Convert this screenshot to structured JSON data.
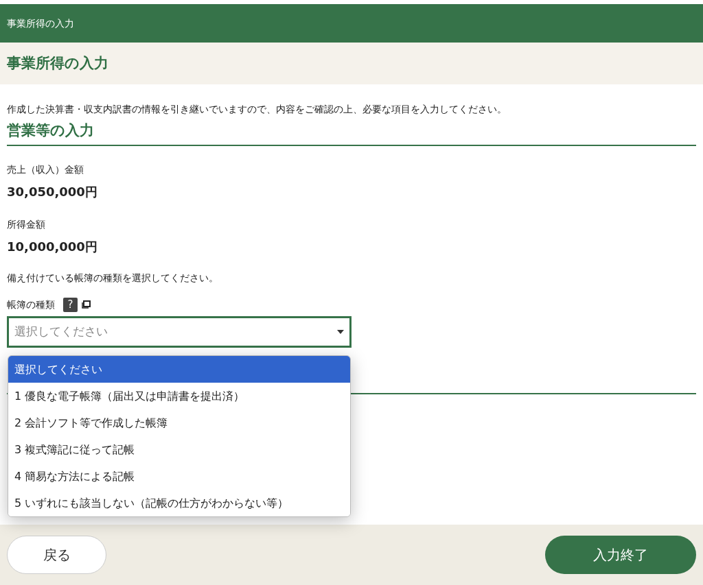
{
  "header": {
    "title": "事業所得の入力"
  },
  "page_title": "事業所得の入力",
  "intro": "作成した決算書・収支内訳書の情報を引き継いでいますので、内容をご確認の上、必要な項目を入力してください。",
  "section_title": "営業等の入力",
  "fields": [
    {
      "label": "売上（収入）金額",
      "value": "30,050,000円"
    },
    {
      "label": "所得金額",
      "value": "10,000,000円"
    }
  ],
  "instruction": "備え付けている帳簿の種類を選択してください。",
  "select": {
    "label": "帳簿の種類",
    "help": "?",
    "placeholder": "選択してください",
    "expanded": true,
    "options": [
      {
        "label": "選択してください",
        "selected": true
      },
      {
        "label": "1 優良な電子帳簿（届出又は申請書を提出済）",
        "selected": false
      },
      {
        "label": "2 会計ソフト等で作成した帳簿",
        "selected": false
      },
      {
        "label": "3 複式簿記に従って記帳",
        "selected": false
      },
      {
        "label": "4 簡易な方法による記帳",
        "selected": false
      },
      {
        "label": "5 いずれにも該当しない（記帳の仕方がわからない等）",
        "selected": false
      }
    ]
  },
  "footer": {
    "back": "戻る",
    "finish": "入力終了"
  }
}
